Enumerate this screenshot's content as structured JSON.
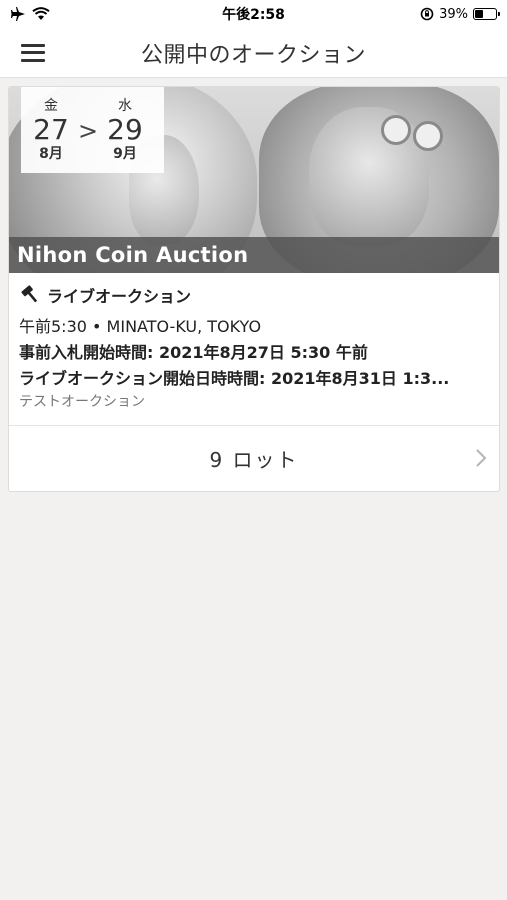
{
  "status_bar": {
    "time": "午後2:58",
    "battery": "39%",
    "battery_level": 0.39
  },
  "nav": {
    "title": "公開中のオークション",
    "menu_icon": "hamburger-menu-icon"
  },
  "auction": {
    "start_dow": "金",
    "start_day": "27",
    "start_month": "8月",
    "arrow": ">",
    "end_dow": "水",
    "end_day": "29",
    "end_month": "9月",
    "name": "Nihon Coin Auction",
    "type_label": "ライブオークション",
    "type_icon": "gavel-icon",
    "time_location": "午前5:30 • MINATO-KU, TOKYO",
    "prebid_start": "事前入札開始時間: 2021年8月27日 5:30 午前",
    "live_start": "ライブオークション開始日時時間: 2021年8月31日 1:3...",
    "description": "テストオークション",
    "lots": "9 ロット"
  },
  "colors": {
    "background": "#f2f1ef",
    "card": "#ffffff",
    "banner": "#505050"
  }
}
